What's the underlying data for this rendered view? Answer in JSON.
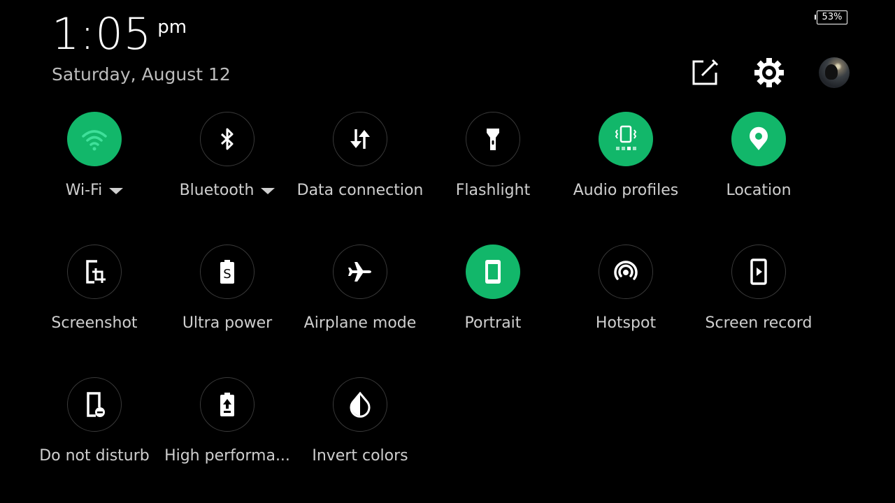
{
  "status": {
    "time": "1:05",
    "ampm": "pm",
    "date": "Saturday, August 12",
    "battery": "53%"
  },
  "header": {
    "edit_icon": "edit-icon",
    "settings_icon": "gear-icon",
    "avatar": "user-avatar"
  },
  "accent_color": "#12b76a",
  "tiles": [
    {
      "label": "Wi-Fi",
      "icon": "wifi-icon",
      "active": true,
      "dropdown": true
    },
    {
      "label": "Bluetooth",
      "icon": "bluetooth-icon",
      "active": false,
      "dropdown": true
    },
    {
      "label": "Data connection",
      "icon": "data-arrows-icon",
      "active": false
    },
    {
      "label": "Flashlight",
      "icon": "flashlight-icon",
      "active": false
    },
    {
      "label": "Audio profiles",
      "icon": "vibrate-icon",
      "active": true
    },
    {
      "label": "Location",
      "icon": "location-pin-icon",
      "active": true
    },
    {
      "label": "Screenshot",
      "icon": "screenshot-icon",
      "active": false
    },
    {
      "label": "Ultra power",
      "icon": "ultra-power-icon",
      "active": false
    },
    {
      "label": "Airplane mode",
      "icon": "airplane-icon",
      "active": false
    },
    {
      "label": "Portrait",
      "icon": "portrait-icon",
      "active": true
    },
    {
      "label": "Hotspot",
      "icon": "hotspot-icon",
      "active": false
    },
    {
      "label": "Screen record",
      "icon": "screen-record-icon",
      "active": false
    },
    {
      "label": "Do not disturb",
      "icon": "do-not-disturb-icon",
      "active": false
    },
    {
      "label": "High performa...",
      "icon": "high-performance-icon",
      "active": false
    },
    {
      "label": "Invert colors",
      "icon": "invert-colors-icon",
      "active": false
    }
  ]
}
